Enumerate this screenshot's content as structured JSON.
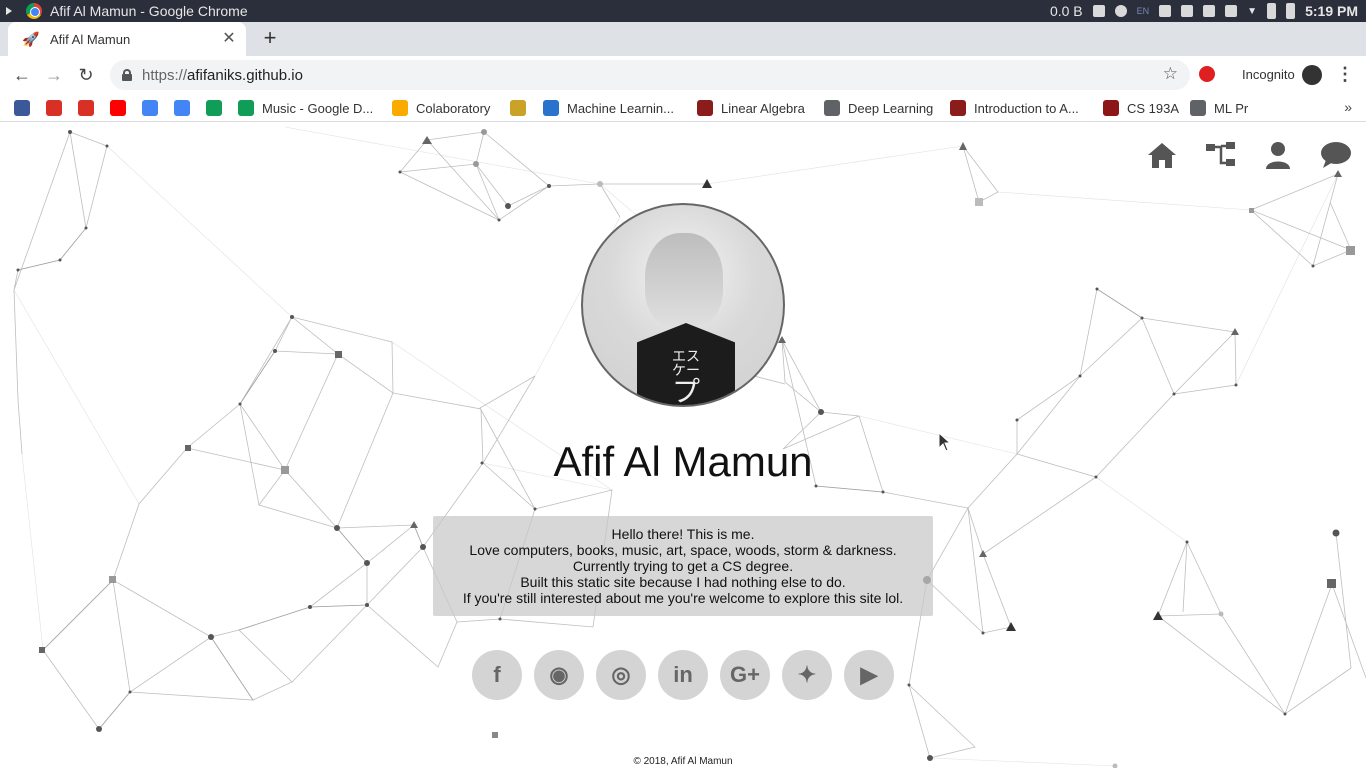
{
  "os": {
    "window_title": "Afif Al Mamun - Google Chrome",
    "net_speed": "0.0 B",
    "lang": "EN",
    "clock": "5:19 PM"
  },
  "browser": {
    "tab_title": "Afif Al Mamun",
    "url_scheme": "https://",
    "url_host": "afifaniks.github.io",
    "incognito_label": "Incognito",
    "bookmarks": [
      {
        "label": "",
        "icon": "facebook-icon",
        "color": "#3b5998"
      },
      {
        "label": "",
        "icon": "gmail-icon",
        "color": "#d93025"
      },
      {
        "label": "",
        "icon": "gmail-icon",
        "color": "#d93025"
      },
      {
        "label": "",
        "icon": "youtube-icon",
        "color": "#ff0000"
      },
      {
        "label": "",
        "icon": "translate-icon",
        "color": "#4285f4"
      },
      {
        "label": "",
        "icon": "google-icon",
        "color": "#4285f4"
      },
      {
        "label": "",
        "icon": "drive-icon",
        "color": "#0f9d58"
      },
      {
        "label": "Music - Google D...",
        "icon": "drive-icon",
        "color": "#0f9d58"
      },
      {
        "label": "Colaboratory",
        "icon": "colab-icon",
        "color": "#f9ab00"
      },
      {
        "label": "",
        "icon": "trophy-icon",
        "color": "#c9a227"
      },
      {
        "label": "Machine Learnin...",
        "icon": "coursera-icon",
        "color": "#2a73cc"
      },
      {
        "label": "Linear Algebra",
        "icon": "mit-icon",
        "color": "#8a1c1c"
      },
      {
        "label": "Deep Learning",
        "icon": "folder-icon",
        "color": "#5f6368"
      },
      {
        "label": "Introduction to A...",
        "icon": "mit-icon",
        "color": "#8a1c1c"
      },
      {
        "label": "CS 193A",
        "icon": "stanford-icon",
        "color": "#8c1515"
      },
      {
        "label": "ML Pr",
        "icon": "network-icon",
        "color": "#5f6368"
      }
    ],
    "bookmarks_more": "»"
  },
  "page": {
    "nav": [
      "home-icon",
      "sitemap-icon",
      "user-icon",
      "chat-icon"
    ],
    "name": "Afif Al Mamun",
    "shirt_small": "エス",
    "shirt_small2": "ケー",
    "shirt_big": "プ",
    "bio_lines": [
      "Hello there! This is me.",
      "Love computers, books, music, art, space, woods, storm & darkness.",
      "Currently trying to get a CS degree.",
      "Built this static site because I had nothing else to do.",
      "If you're still interested about me you're welcome to explore this site lol."
    ],
    "social": [
      {
        "name": "facebook-icon",
        "glyph": "f"
      },
      {
        "name": "github-icon",
        "glyph": "◉"
      },
      {
        "name": "instagram-icon",
        "glyph": "◎"
      },
      {
        "name": "linkedin-icon",
        "glyph": "in"
      },
      {
        "name": "google-plus-icon",
        "glyph": "G+"
      },
      {
        "name": "twitter-icon",
        "glyph": "✦"
      },
      {
        "name": "youtube-icon",
        "glyph": "▶"
      }
    ],
    "footer": "© 2018, Afif Al Mamun"
  }
}
